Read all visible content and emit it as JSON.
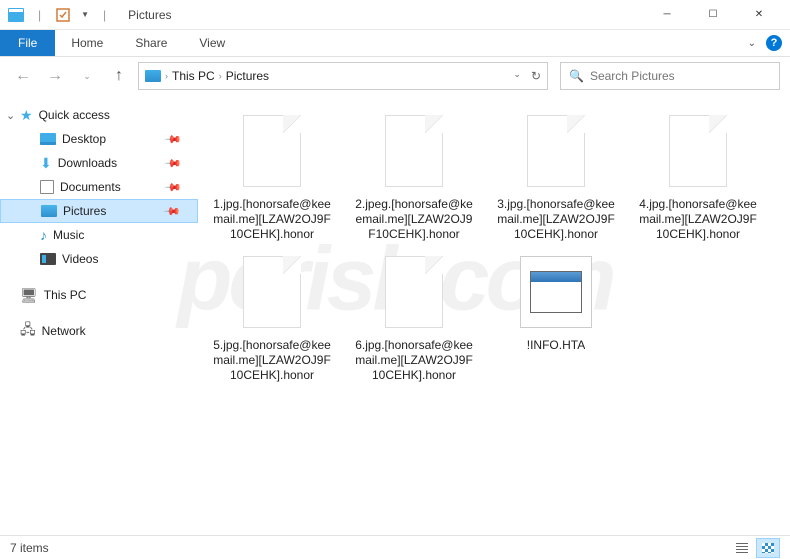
{
  "titlebar": {
    "title": "Pictures"
  },
  "ribbon": {
    "file": "File",
    "tabs": [
      "Home",
      "Share",
      "View"
    ]
  },
  "breadcrumb": {
    "items": [
      "This PC",
      "Pictures"
    ]
  },
  "search": {
    "placeholder": "Search Pictures"
  },
  "sidebar": {
    "quick_access": "Quick access",
    "items": [
      {
        "label": "Desktop",
        "pinned": true
      },
      {
        "label": "Downloads",
        "pinned": true
      },
      {
        "label": "Documents",
        "pinned": true
      },
      {
        "label": "Pictures",
        "pinned": true,
        "selected": true
      },
      {
        "label": "Music"
      },
      {
        "label": "Videos"
      }
    ],
    "this_pc": "This PC",
    "network": "Network"
  },
  "files": [
    {
      "name": "1.jpg.[honorsafe@keemail.me][LZAW2OJ9F10CEHK].honor",
      "type": "blank"
    },
    {
      "name": "2.jpeg.[honorsafe@keemail.me][LZAW2OJ9F10CEHK].honor",
      "type": "blank"
    },
    {
      "name": "3.jpg.[honorsafe@keemail.me][LZAW2OJ9F10CEHK].honor",
      "type": "blank"
    },
    {
      "name": "4.jpg.[honorsafe@keemail.me][LZAW2OJ9F10CEHK].honor",
      "type": "blank"
    },
    {
      "name": "5.jpg.[honorsafe@keemail.me][LZAW2OJ9F10CEHK].honor",
      "type": "blank"
    },
    {
      "name": "6.jpg.[honorsafe@keemail.me][LZAW2OJ9F10CEHK].honor",
      "type": "blank"
    },
    {
      "name": "!INFO.HTA",
      "type": "hta"
    }
  ],
  "status": {
    "count": "7 items"
  },
  "watermark": "pcrisk.com"
}
